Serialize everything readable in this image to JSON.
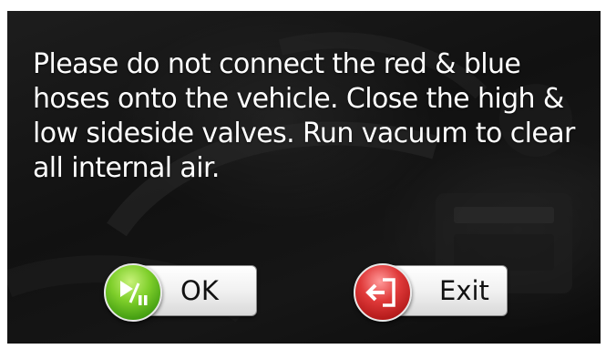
{
  "dialog": {
    "message": "Please do not connect the red & blue hoses onto the vehicle. Close the high & low sideside valves. Run vacuum to clear all internal air."
  },
  "buttons": {
    "ok_label": "OK",
    "exit_label": "Exit"
  },
  "icons": {
    "ok": "play-pause-icon",
    "exit": "exit-door-icon"
  },
  "colors": {
    "ok_accent": "#5cb81c",
    "exit_accent": "#cc2424",
    "text": "#ffffff"
  }
}
